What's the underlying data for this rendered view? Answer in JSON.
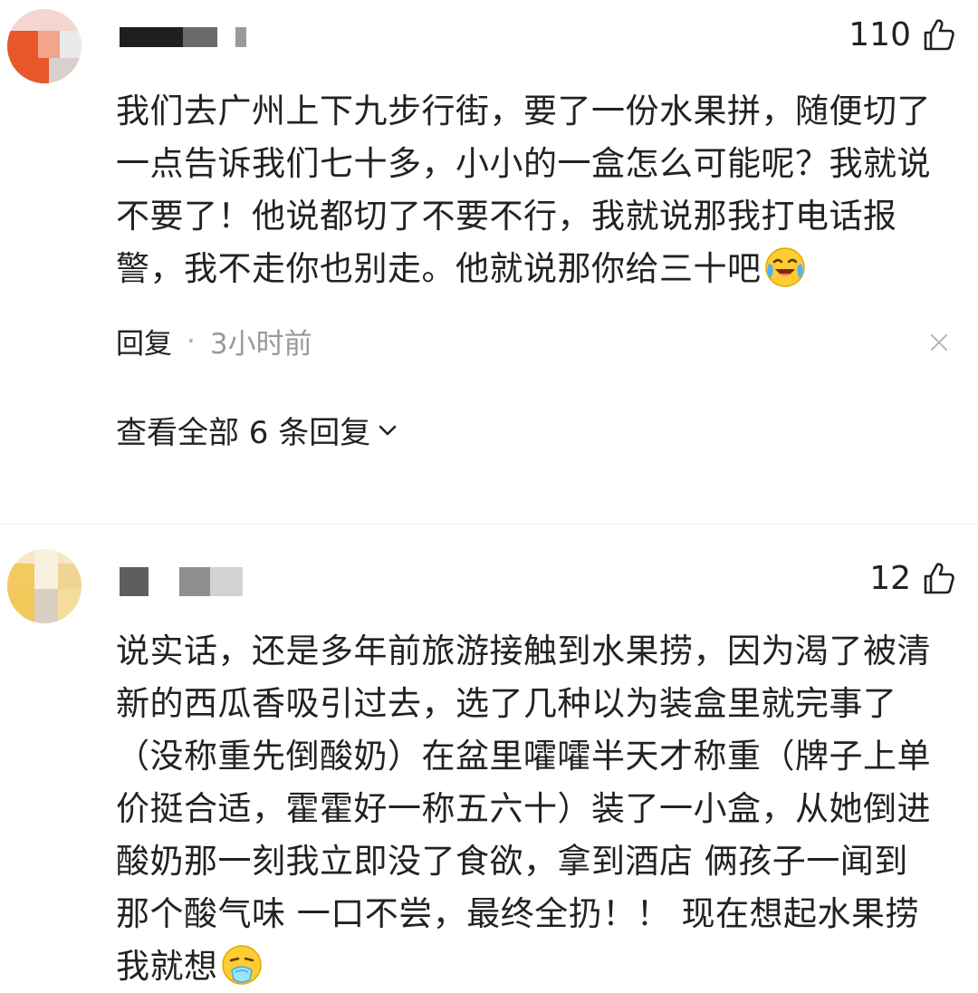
{
  "comments": [
    {
      "likes": "110",
      "lines": [
        "我们去广州上下九步行街，要了一份水果拼，随便切了",
        "一点告诉我们七十多，小小的一盒怎么可能呢？我就说",
        "不要了！他说都切了不要不行，我就说那我打电话报",
        "警，我不走你也别走。他就说那你给三十吧"
      ],
      "emoji_icon": "crying-laughing-emoji",
      "reply_label": "回复",
      "time": "3小时前",
      "view_replies_label": "查看全部 6 条回复"
    },
    {
      "likes": "12",
      "lines": [
        "说实话，还是多年前旅游接触到水果捞，因为渴了被清",
        "新的西瓜香吸引过去，选了几种以为装盒里就完事了",
        "（没称重先倒酸奶）在盆里嚯嚯半天才称重（牌子上单",
        "价挺合适，霍霍好一称五六十）装了一小盒，从她倒进",
        "酸奶那一刻我立即没了食欲，拿到酒店 俩孩子一闻到",
        "那个酸气味 一口不尝，最终全扔！！ 现在想起水果捞",
        "我就想"
      ],
      "emoji_icon": "nauseated-emoji"
    }
  ],
  "colors": {
    "text": "#222222",
    "muted": "#999999"
  }
}
